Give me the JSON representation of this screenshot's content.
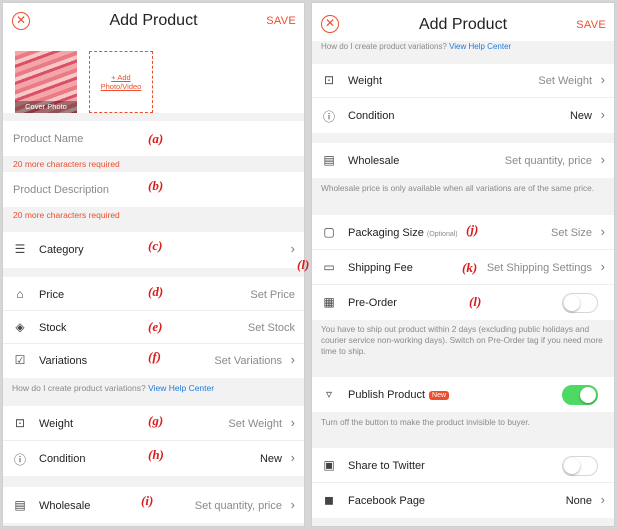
{
  "left": {
    "header": {
      "title": "Add Product",
      "save_label": "SAVE"
    },
    "cover_caption": "Cover Photo",
    "add_media_label": "+ Add\nPhoto/Video",
    "product_name_placeholder": "Product Name",
    "product_name_error": "20 more characters required",
    "product_desc_placeholder": "Product Description",
    "product_desc_error": "20 more characters required",
    "category_label": "Category",
    "price_label": "Price",
    "price_value": "Set Price",
    "stock_label": "Stock",
    "stock_value": "Set Stock",
    "variations_label": "Variations",
    "variations_value": "Set Variations",
    "help_text": "How do I create product variations?",
    "help_link": "View Help Center",
    "weight_label": "Weight",
    "weight_value": "Set Weight",
    "condition_label": "Condition",
    "condition_value": "New",
    "wholesale_label": "Wholesale",
    "wholesale_value": "Set quantity, price",
    "annotations": {
      "a": "(a)",
      "b": "(b)",
      "c": "(c)",
      "d": "(d)",
      "e": "(e)",
      "f": "(f)",
      "g": "(g)",
      "h": "(h)",
      "i": "(i)"
    }
  },
  "right": {
    "header": {
      "title": "Add Product",
      "save_label": "SAVE"
    },
    "help_text": "How do I create product variations?",
    "help_link": "View Help Center",
    "weight_label": "Weight",
    "weight_value": "Set Weight",
    "condition_label": "Condition",
    "condition_value": "New",
    "wholesale_label": "Wholesale",
    "wholesale_value": "Set quantity, price",
    "wholesale_note": "Wholesale price is only available when all variations are of the same price.",
    "packaging_label": "Packaging Size",
    "packaging_optional": "(Optional)",
    "packaging_value": "Set Size",
    "shipping_label": "Shipping Fee",
    "shipping_value": "Set Shipping Settings",
    "preorder_label": "Pre-Order",
    "preorder_note": "You have to ship out product within 2 days (excluding public holidays and courier service non-working days). Switch on Pre-Order tag if you need more time to ship.",
    "publish_label": "Publish Product",
    "publish_badge": "New",
    "publish_note": "Turn off the button to make the product invisible to buyer.",
    "twitter_label": "Share to Twitter",
    "facebook_label": "Facebook Page",
    "facebook_value": "None",
    "annotations": {
      "j": "(j)",
      "k": "(k)",
      "l": "(l)",
      "l2": "(l)"
    }
  },
  "toggles": {
    "preorder": false,
    "publish": true,
    "twitter": false
  },
  "colors": {
    "accent": "#ee4d2d",
    "link": "#1e7bd8",
    "toggle_on": "#4cd964",
    "annotation": "#d91c1c"
  },
  "icons": {
    "close": "close-icon",
    "category": "list-icon",
    "price": "tag-icon",
    "stock": "layers-icon",
    "variations": "edit-box-icon",
    "weight": "scale-icon",
    "condition": "info-icon",
    "wholesale": "wholesale-icon",
    "packaging": "box-icon",
    "shipping": "truck-icon",
    "preorder": "calendar-icon",
    "publish": "publish-icon",
    "twitter": "twitter-icon",
    "facebook": "facebook-icon"
  }
}
